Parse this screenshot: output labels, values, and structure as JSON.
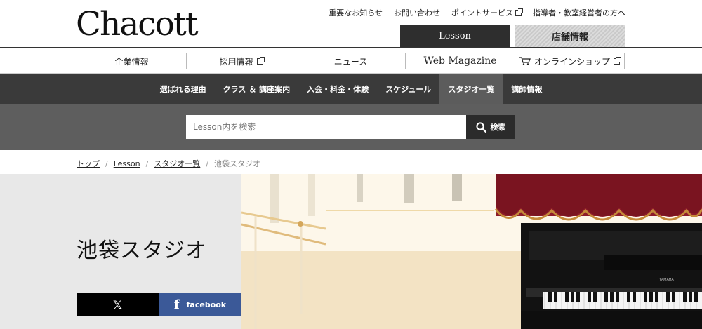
{
  "logo": "Chacott",
  "top_links": [
    {
      "label": "重要なお知らせ",
      "external": false
    },
    {
      "label": "お問い合わせ",
      "external": false
    },
    {
      "label": "ポイントサービス",
      "external": true
    },
    {
      "label": "指導者・教室経営者の方へ",
      "external": false
    }
  ],
  "site_tabs": {
    "lesson": "Lesson",
    "store": "店舗情報"
  },
  "global_nav": [
    {
      "label": "企業情報",
      "external": false
    },
    {
      "label": "採用情報",
      "external": true
    },
    {
      "label": "ニュース",
      "external": false
    },
    {
      "label": "Web Magazine",
      "external": false
    },
    {
      "label": "オンラインショップ",
      "external": true
    }
  ],
  "lesson_nav": [
    {
      "label": "選ばれる理由",
      "active": false
    },
    {
      "label": "クラス ＆ 講座案内",
      "active": false
    },
    {
      "label": "入会・料金・体験",
      "active": false
    },
    {
      "label": "スケジュール",
      "active": false
    },
    {
      "label": "スタジオ一覧",
      "active": true
    },
    {
      "label": "講師情報",
      "active": false
    }
  ],
  "search": {
    "placeholder": "Lesson内を検索",
    "button": "検索"
  },
  "breadcrumb": {
    "items": [
      "トップ",
      "Lesson",
      "スタジオ一覧"
    ],
    "current": "池袋スタジオ"
  },
  "hero": {
    "title": "池袋スタジオ",
    "share_x": "𝕏",
    "share_fb": "facebook",
    "fb_glyph": "f",
    "piano_brand": "YAMAHA"
  },
  "colors": {
    "dark": "#3a3a3a",
    "active": "#5c5c5c",
    "facebook": "#3b5998",
    "search_band": "#5e5e5e"
  }
}
